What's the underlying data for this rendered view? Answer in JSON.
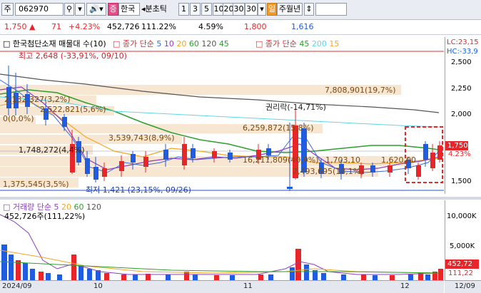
{
  "toolbar": {
    "market_label": "주",
    "code_value": "062970",
    "name_badge": "증",
    "name_value": "한국",
    "period_label": "분초틱",
    "periods": [
      "1",
      "3",
      "5",
      "10",
      "20",
      "30"
    ],
    "period_selected": "30",
    "tab_day": "일",
    "tab_rest": "주월년"
  },
  "info": {
    "price": "1,750",
    "change": "71",
    "change_pct": "+4.23%",
    "volume": "452,726",
    "volume_pct": "111.22%",
    "rate": "4.59%",
    "high": "1,800",
    "low": "1,616"
  },
  "legend": {
    "title": "한국첨단소재 매물대 수(10)",
    "ma_title": "종가 단순",
    "ma_periods": [
      "5",
      "10",
      "20",
      "60",
      "120",
      "45"
    ],
    "ma2_title": "종가 단순",
    "ma2_periods": [
      "45",
      "200",
      "15"
    ],
    "lc": "LC:23,15",
    "hc": "HC:-33,9"
  },
  "annotations": {
    "high": "최고 2,648 (-33,91%, 09/10)",
    "low": "최저 1,421 (23,15%, 09/26)",
    "rights": "권리락(-14,71%)"
  },
  "bands": [
    {
      "label": "7,808,901(19,7%)"
    },
    {
      "label": "2,132,327(3,2%)"
    },
    {
      "label": "2,522,821(5,6%)"
    },
    {
      "label": "0(0,0%)"
    },
    {
      "label": "3,539,743(8,9%)"
    },
    {
      "label": "6,259,872(15,8%)"
    },
    {
      "label": "1,748,272(4,4%)"
    },
    {
      "label": "16,211,809(40,9%)"
    },
    {
      "label": "1,703,10"
    },
    {
      "label": "1,620,00"
    },
    {
      "label": "7,493,695(18,1%)"
    },
    {
      "label": "1,375,545(3,5%)"
    }
  ],
  "price_axis": [
    "2,500",
    "2,250",
    "2,000",
    "1,750",
    "1,500"
  ],
  "current_price_tag": "1,750",
  "current_pct_tag": "4.23%",
  "volume_legend": {
    "title": "거래량 단순",
    "periods": [
      "5",
      "20",
      "60",
      "120"
    ],
    "value": "452,726주(111,22%)"
  },
  "volume_axis": [
    "10,000K",
    "5,000K"
  ],
  "volume_tag": "452,72",
  "volume_tag2": "111,22",
  "x_axis": [
    "2024/09",
    "10",
    "11",
    "12",
    "12/09"
  ],
  "colors": {
    "up": "#e8262a",
    "down": "#1f5ce0",
    "band": "#f7e6d2",
    "ma60": "#2ca02c",
    "ma120": "#555555"
  }
}
